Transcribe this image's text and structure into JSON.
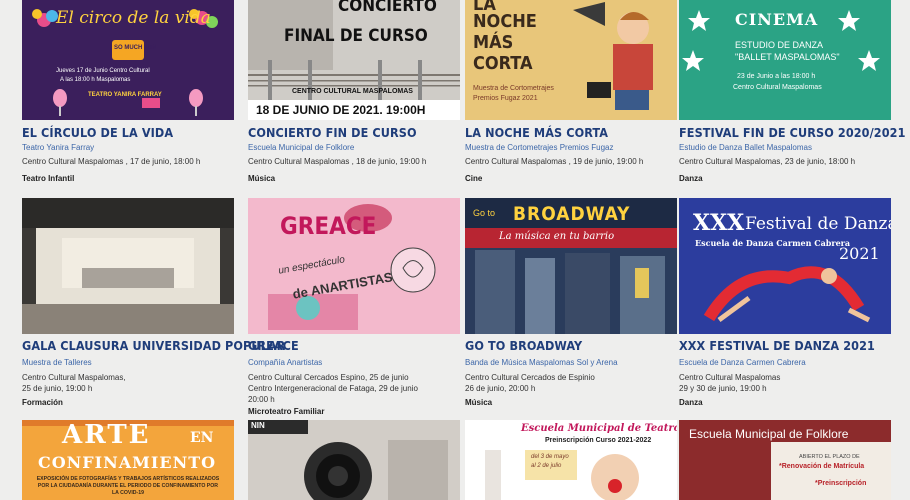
{
  "events": [
    {
      "title": "EL CÍRCULO DE LA VIDA",
      "org": "Teatro Yanira Farray",
      "place": "Centro Cultural Maspalomas , 17 de junio, 18:00 h",
      "category": "Teatro Infantil",
      "poster": {
        "heading": "El circo de la vida",
        "badge": "SO MUCH FUN",
        "info": "Jueves 17 de Junio  Centro Cultural",
        "info2": "A las 18:00 h   Maspalomas",
        "footer": "TEATRO YANIRA FARRAY"
      }
    },
    {
      "title": "CONCIERTO FIN DE CURSO",
      "org": "Escuela Municipal de Folklore",
      "place": "Centro Cultural Maspalomas , 18 de junio, 19:00 h",
      "category": "Música",
      "poster": {
        "line1": "CONCIERTO",
        "line2": "FINAL DE CURSO",
        "venue": "CENTRO CULTURAL MASPALOMAS",
        "date": "18 DE JUNIO DE 2021. 19:00H"
      }
    },
    {
      "title": "LA NOCHE MÁS CORTA",
      "org": "Muestra de Cortometrajes Premios Fugaz",
      "place": "Centro Cultural Maspalomas , 19 de junio, 19:00 h",
      "category": "Cine",
      "poster": {
        "line1": "LA",
        "line2": "NOCHE",
        "line3": "MÁS",
        "line4": "CORTA",
        "sub1": "Muestra de Cortometrajes",
        "sub2": "Premios Fugaz 2021"
      }
    },
    {
      "title": "FESTIVAL FIN DE CURSO 2020/2021",
      "org": "Estudio de Danza Ballet Maspalomas",
      "place": "Centro Cultural Maspalomas, 23 de junio, 18:00 h",
      "category": "Danza",
      "poster": {
        "heading": "CINEMA",
        "line1": "ESTUDIO DE DANZA",
        "line2": "\"BALLET MASPALOMAS\"",
        "line3": "23 de Junio a las 18:00 h",
        "line4": "Centro Cultural Maspalomas"
      }
    },
    {
      "title": "GALA CLAUSURA UNIVERSIDAD POPULAR",
      "org": "Muestra de Talleres",
      "place": "Centro Cultural Maspalomas,",
      "place2": "25 de junio, 19:00 h",
      "category": "Formación"
    },
    {
      "title": "GREACE",
      "org": "Compañía Anartistas",
      "place": "Centro Cultural Cercados Espino, 25 de junio",
      "place2": "Centro Intergeneracional de Fataga, 29 de junio",
      "place3": "20:00 h",
      "category": "Microteatro Familiar",
      "poster": {
        "heading": "GREACE",
        "line1": "un espectáculo",
        "line2": "de ANARTISTAS"
      }
    },
    {
      "title": "GO TO BROADWAY",
      "org": "Banda de Música Maspalomas Sol y Arena",
      "place": "Centro Cultural Cercados de Espinio",
      "place2": "26 de junio, 20:00 h",
      "category": "Música",
      "poster": {
        "small": "Go to",
        "heading": "BROADWAY",
        "sub": "La música en tu barrio"
      }
    },
    {
      "title": "XXX FESTIVAL DE DANZA 2021",
      "org": "Escuela de Danza Carmen Cabrera",
      "place": "Centro Cultural Maspalomas",
      "place2": "29 y 30 de junio, 19:00 h",
      "category": "Danza",
      "poster": {
        "xxx": "XXX",
        "heading": "Festival de Danza",
        "sub": "Escuela de Danza  Carmen Cabrera",
        "year": "2021"
      }
    },
    {
      "poster": {
        "line1": "ARTE",
        "line2": "EN",
        "line3": "CONFINAMIENTO",
        "sub": "EXPOSICIÓN DE FOTOGRAFÍAS Y TRABAJOS ARTÍSTICOS REALIZADOS POR LA CIUDADANÍA DURANTE EL PERIODO DE CONFINAMIENTO POR LA COVID-19"
      }
    },
    {
      "poster": {
        "text": "NIN"
      }
    },
    {
      "poster": {
        "heading": "Escuela Municipal de Teatro",
        "sub": "Preinscripción Curso 2021-2022",
        "note1": "del 3 de mayo",
        "note2": "al 2 de julio"
      }
    },
    {
      "poster": {
        "heading": "Escuela Municipal de Folklore",
        "line1": "ABIERTO EL PLAZO DE",
        "line2": "*Renovación de Matrícula",
        "line3": "*Preinscripción"
      }
    }
  ],
  "colors": {
    "background": "#eeeeed",
    "title": "#1f3d7a",
    "org": "#3c66a8",
    "text": "#333333"
  }
}
